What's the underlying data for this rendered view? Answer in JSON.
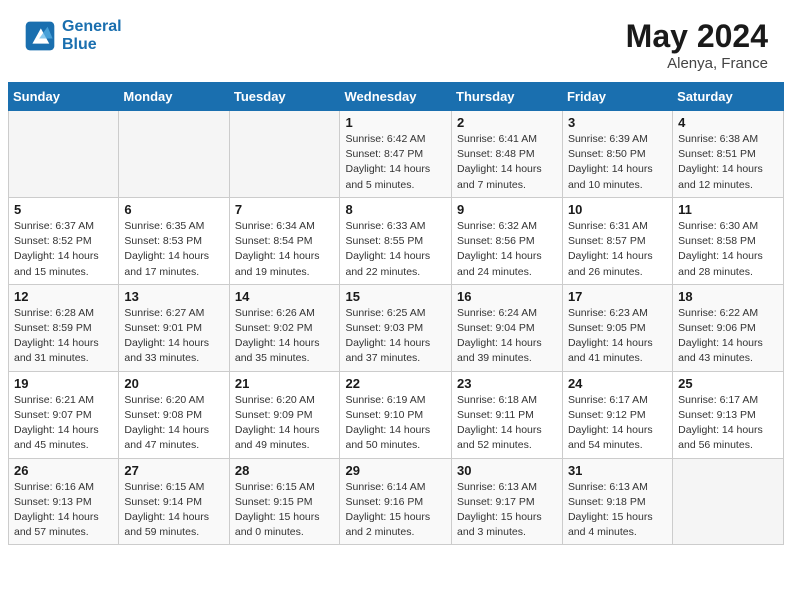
{
  "header": {
    "logo_line1": "General",
    "logo_line2": "Blue",
    "month_year": "May 2024",
    "location": "Alenya, France"
  },
  "days_of_week": [
    "Sunday",
    "Monday",
    "Tuesday",
    "Wednesday",
    "Thursday",
    "Friday",
    "Saturday"
  ],
  "weeks": [
    [
      {
        "num": "",
        "info": ""
      },
      {
        "num": "",
        "info": ""
      },
      {
        "num": "",
        "info": ""
      },
      {
        "num": "1",
        "info": "Sunrise: 6:42 AM\nSunset: 8:47 PM\nDaylight: 14 hours\nand 5 minutes."
      },
      {
        "num": "2",
        "info": "Sunrise: 6:41 AM\nSunset: 8:48 PM\nDaylight: 14 hours\nand 7 minutes."
      },
      {
        "num": "3",
        "info": "Sunrise: 6:39 AM\nSunset: 8:50 PM\nDaylight: 14 hours\nand 10 minutes."
      },
      {
        "num": "4",
        "info": "Sunrise: 6:38 AM\nSunset: 8:51 PM\nDaylight: 14 hours\nand 12 minutes."
      }
    ],
    [
      {
        "num": "5",
        "info": "Sunrise: 6:37 AM\nSunset: 8:52 PM\nDaylight: 14 hours\nand 15 minutes."
      },
      {
        "num": "6",
        "info": "Sunrise: 6:35 AM\nSunset: 8:53 PM\nDaylight: 14 hours\nand 17 minutes."
      },
      {
        "num": "7",
        "info": "Sunrise: 6:34 AM\nSunset: 8:54 PM\nDaylight: 14 hours\nand 19 minutes."
      },
      {
        "num": "8",
        "info": "Sunrise: 6:33 AM\nSunset: 8:55 PM\nDaylight: 14 hours\nand 22 minutes."
      },
      {
        "num": "9",
        "info": "Sunrise: 6:32 AM\nSunset: 8:56 PM\nDaylight: 14 hours\nand 24 minutes."
      },
      {
        "num": "10",
        "info": "Sunrise: 6:31 AM\nSunset: 8:57 PM\nDaylight: 14 hours\nand 26 minutes."
      },
      {
        "num": "11",
        "info": "Sunrise: 6:30 AM\nSunset: 8:58 PM\nDaylight: 14 hours\nand 28 minutes."
      }
    ],
    [
      {
        "num": "12",
        "info": "Sunrise: 6:28 AM\nSunset: 8:59 PM\nDaylight: 14 hours\nand 31 minutes."
      },
      {
        "num": "13",
        "info": "Sunrise: 6:27 AM\nSunset: 9:01 PM\nDaylight: 14 hours\nand 33 minutes."
      },
      {
        "num": "14",
        "info": "Sunrise: 6:26 AM\nSunset: 9:02 PM\nDaylight: 14 hours\nand 35 minutes."
      },
      {
        "num": "15",
        "info": "Sunrise: 6:25 AM\nSunset: 9:03 PM\nDaylight: 14 hours\nand 37 minutes."
      },
      {
        "num": "16",
        "info": "Sunrise: 6:24 AM\nSunset: 9:04 PM\nDaylight: 14 hours\nand 39 minutes."
      },
      {
        "num": "17",
        "info": "Sunrise: 6:23 AM\nSunset: 9:05 PM\nDaylight: 14 hours\nand 41 minutes."
      },
      {
        "num": "18",
        "info": "Sunrise: 6:22 AM\nSunset: 9:06 PM\nDaylight: 14 hours\nand 43 minutes."
      }
    ],
    [
      {
        "num": "19",
        "info": "Sunrise: 6:21 AM\nSunset: 9:07 PM\nDaylight: 14 hours\nand 45 minutes."
      },
      {
        "num": "20",
        "info": "Sunrise: 6:20 AM\nSunset: 9:08 PM\nDaylight: 14 hours\nand 47 minutes."
      },
      {
        "num": "21",
        "info": "Sunrise: 6:20 AM\nSunset: 9:09 PM\nDaylight: 14 hours\nand 49 minutes."
      },
      {
        "num": "22",
        "info": "Sunrise: 6:19 AM\nSunset: 9:10 PM\nDaylight: 14 hours\nand 50 minutes."
      },
      {
        "num": "23",
        "info": "Sunrise: 6:18 AM\nSunset: 9:11 PM\nDaylight: 14 hours\nand 52 minutes."
      },
      {
        "num": "24",
        "info": "Sunrise: 6:17 AM\nSunset: 9:12 PM\nDaylight: 14 hours\nand 54 minutes."
      },
      {
        "num": "25",
        "info": "Sunrise: 6:17 AM\nSunset: 9:13 PM\nDaylight: 14 hours\nand 56 minutes."
      }
    ],
    [
      {
        "num": "26",
        "info": "Sunrise: 6:16 AM\nSunset: 9:13 PM\nDaylight: 14 hours\nand 57 minutes."
      },
      {
        "num": "27",
        "info": "Sunrise: 6:15 AM\nSunset: 9:14 PM\nDaylight: 14 hours\nand 59 minutes."
      },
      {
        "num": "28",
        "info": "Sunrise: 6:15 AM\nSunset: 9:15 PM\nDaylight: 15 hours\nand 0 minutes."
      },
      {
        "num": "29",
        "info": "Sunrise: 6:14 AM\nSunset: 9:16 PM\nDaylight: 15 hours\nand 2 minutes."
      },
      {
        "num": "30",
        "info": "Sunrise: 6:13 AM\nSunset: 9:17 PM\nDaylight: 15 hours\nand 3 minutes."
      },
      {
        "num": "31",
        "info": "Sunrise: 6:13 AM\nSunset: 9:18 PM\nDaylight: 15 hours\nand 4 minutes."
      },
      {
        "num": "",
        "info": ""
      }
    ]
  ]
}
